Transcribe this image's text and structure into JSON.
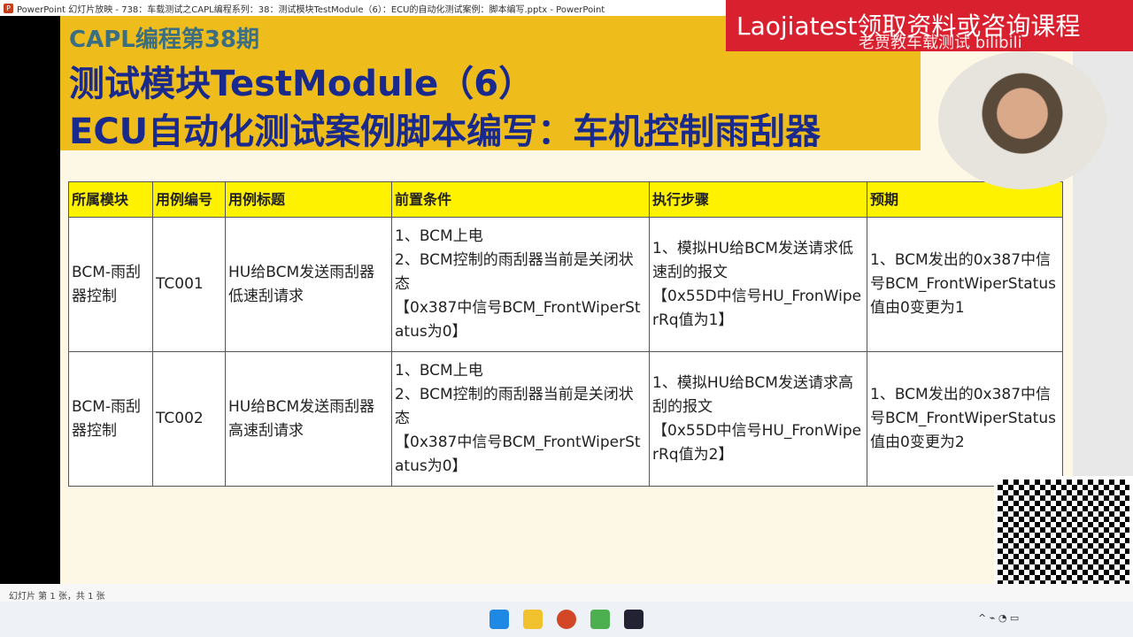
{
  "window": {
    "title": "PowerPoint 幻灯片放映 - 738：车载测试之CAPL编程系列：38：测试模块TestModule（6）：ECU的自动化测试案例：脚本编写.pptx - PowerPoint"
  },
  "slide": {
    "subtitle": "CAPL编程第38期",
    "title1": "测试模块TestModule（6）",
    "title2": "ECU自动化测试案例脚本编写：车机控制雨刮器"
  },
  "table": {
    "headers": [
      "所属模块",
      "用例编号",
      "用例标题",
      "前置条件",
      "执行步骤",
      "预期"
    ],
    "rows": [
      [
        "BCM-雨刮器控制",
        "TC001",
        "HU给BCM发送雨刮器低速刮请求",
        "1、BCM上电\n2、BCM控制的雨刮器当前是关闭状态\n【0x387中信号BCM_FrontWiperStatus为0】",
        "1、模拟HU给BCM发送请求低速刮的报文\n【0x55D中信号HU_FronWiperRq值为1】",
        "1、BCM发出的0x387中信号BCM_FrontWiperStatus值由0变更为1"
      ],
      [
        "BCM-雨刮器控制",
        "TC002",
        "HU给BCM发送雨刮器高速刮请求",
        "1、BCM上电\n2、BCM控制的雨刮器当前是关闭状态\n【0x387中信号BCM_FrontWiperStatus为0】",
        "1、模拟HU给BCM发送请求高刮的报文\n【0x55D中信号HU_FronWiperRq值为2】",
        "1、BCM发出的0x387中信号BCM_FrontWiperStatus值由0变更为2"
      ]
    ]
  },
  "overlay": {
    "banner": "Laojiatest领取资料或咨询课程",
    "watermark": "老贾教车载测试 bilibili"
  },
  "statusbar": {
    "text": "幻灯片 第 1 张，共 1 张"
  }
}
